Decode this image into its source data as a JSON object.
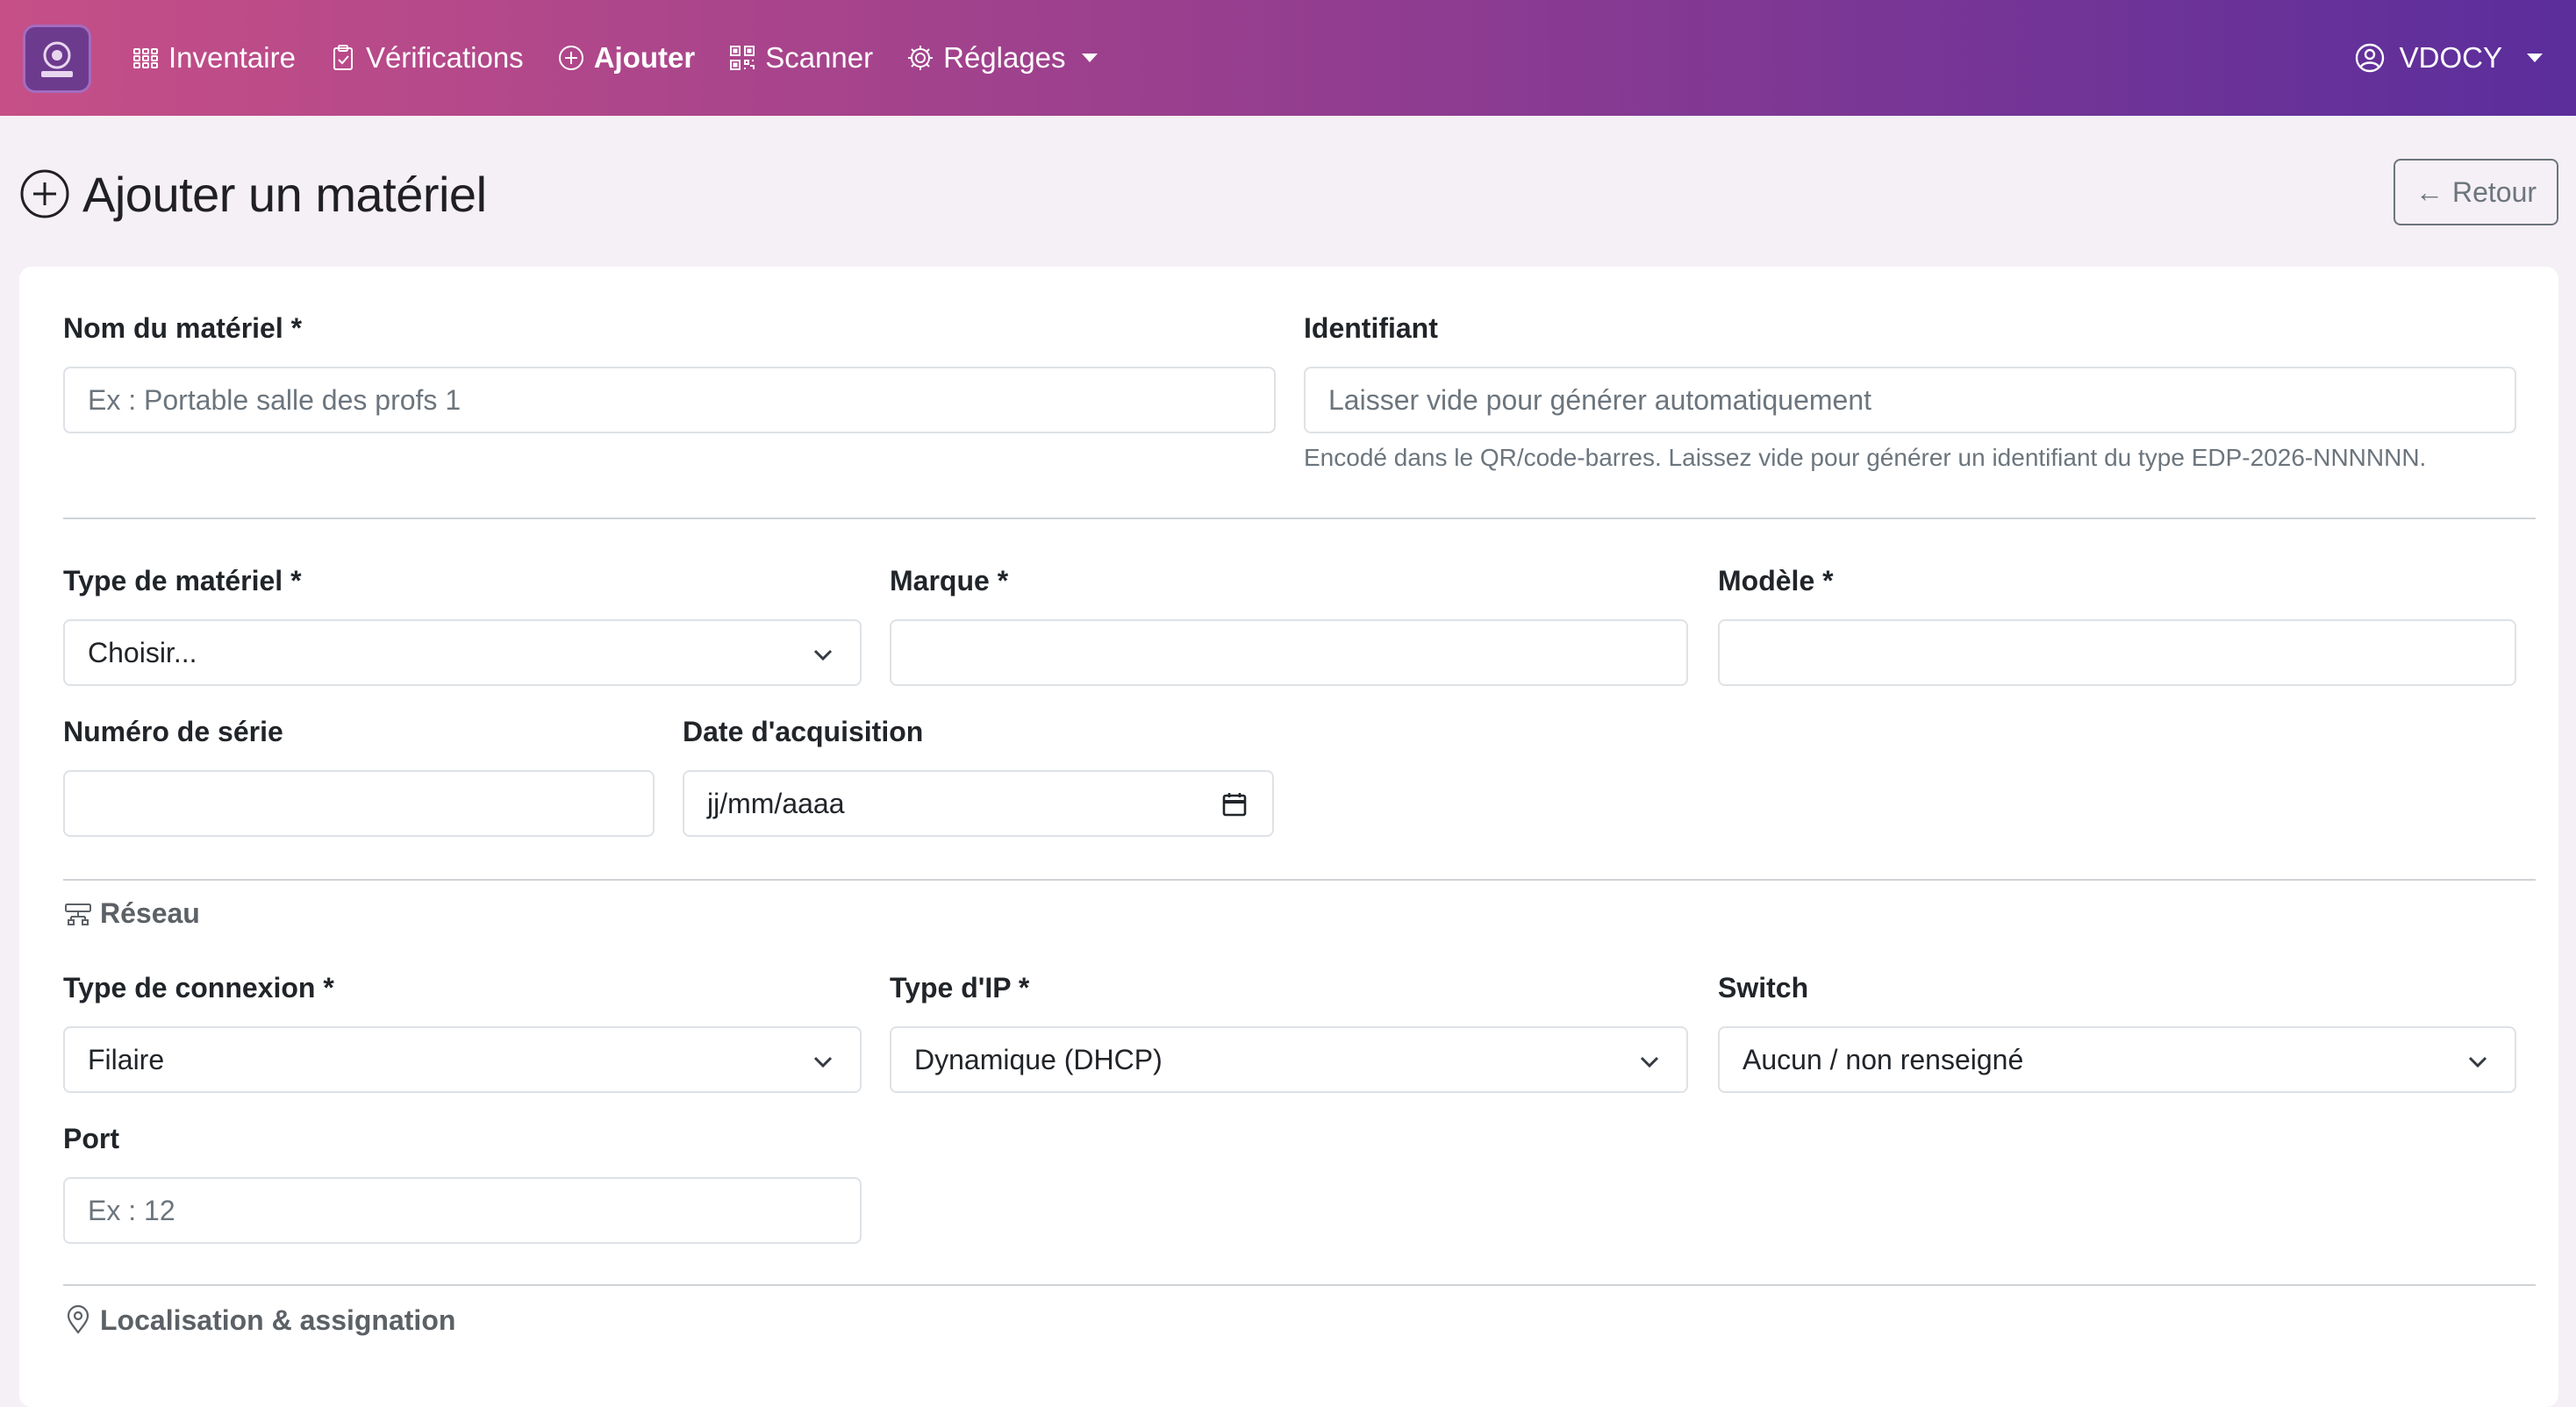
{
  "nav": {
    "items": [
      {
        "label": "Inventaire",
        "icon": "grid-icon"
      },
      {
        "label": "Vérifications",
        "icon": "clipboard-check-icon"
      },
      {
        "label": "Ajouter",
        "icon": "plus-circle-icon"
      },
      {
        "label": "Scanner",
        "icon": "qr-code-icon"
      },
      {
        "label": "Réglages",
        "icon": "gear-icon"
      }
    ],
    "user": "VDOCY"
  },
  "page": {
    "title": "Ajouter un matériel",
    "back_label": "Retour"
  },
  "form": {
    "name": {
      "label": "Nom du matériel *",
      "placeholder": "Ex : Portable salle des profs 1"
    },
    "identifier": {
      "label": "Identifiant",
      "placeholder": "Laisser vide pour générer automatiquement",
      "help": "Encodé dans le QR/code-barres. Laissez vide pour générer un identifiant du type EDP-2026-NNNNNN."
    },
    "type": {
      "label": "Type de matériel *",
      "value": "Choisir..."
    },
    "brand": {
      "label": "Marque *",
      "value": ""
    },
    "model": {
      "label": "Modèle *",
      "value": ""
    },
    "serial": {
      "label": "Numéro de série",
      "value": ""
    },
    "acquisition_date": {
      "label": "Date d'acquisition",
      "value": "jj/mm/aaaa"
    },
    "network_section": "Réseau",
    "connection_type": {
      "label": "Type de connexion *",
      "value": "Filaire"
    },
    "ip_type": {
      "label": "Type d'IP *",
      "value": "Dynamique (DHCP)"
    },
    "switch": {
      "label": "Switch",
      "value": "Aucun / non renseigné"
    },
    "port": {
      "label": "Port",
      "placeholder": "Ex : 12"
    },
    "location_section": "Localisation & assignation"
  }
}
